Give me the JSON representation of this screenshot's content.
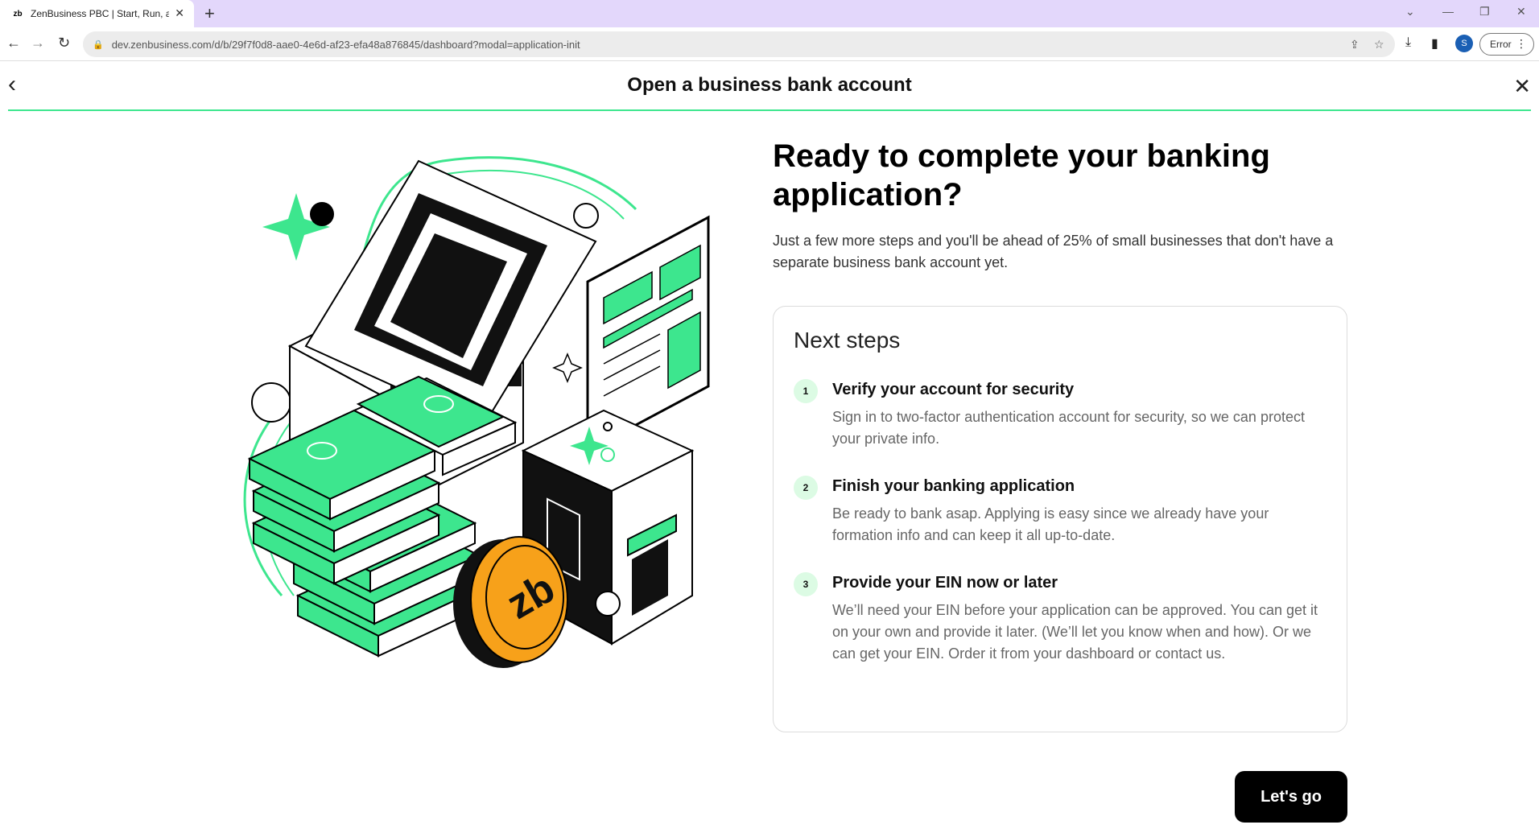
{
  "browser": {
    "tab_title": "ZenBusiness PBC | Start, Run, an",
    "favicon_text": "zb",
    "url": "dev.zenbusiness.com/d/b/29f7f0d8-aae0-4e6d-af23-efa48a876845/dashboard?modal=application-init",
    "profile_initial": "S",
    "error_label": "Error"
  },
  "modal": {
    "title": "Open a business bank account"
  },
  "content": {
    "headline": "Ready to complete your banking application?",
    "subtext": "Just a few more steps and you'll be ahead of 25% of small businesses that don't have a separate business bank account yet."
  },
  "card": {
    "title": "Next steps",
    "steps": [
      {
        "num": "1",
        "title": "Verify your account for security",
        "desc": "Sign in to two-factor authentication account for security, so we can protect your private info."
      },
      {
        "num": "2",
        "title": "Finish your banking application",
        "desc": "Be ready to bank asap. Applying is easy since we already have your formation info and can keep it all up-to-date."
      },
      {
        "num": "3",
        "title": "Provide your EIN now or later",
        "desc": "We’ll need your EIN before your application can be approved. You can get it on your own and provide it later. (We’ll let you know when and how). Or we can get your EIN. Order it from your dashboard or contact us."
      }
    ]
  },
  "cta": {
    "label": "Let's go"
  },
  "colors": {
    "accent_green": "#3de68e",
    "step_badge_bg": "#dcfbe4",
    "coin_orange": "#f7a11a",
    "tabbar_bg": "#e3d7fb"
  },
  "icons": [
    "back-arrow-icon",
    "close-icon",
    "lock-icon",
    "share-icon",
    "star-icon",
    "download-icon",
    "sidepanel-icon",
    "more-icon",
    "reload-icon",
    "forward-icon"
  ]
}
